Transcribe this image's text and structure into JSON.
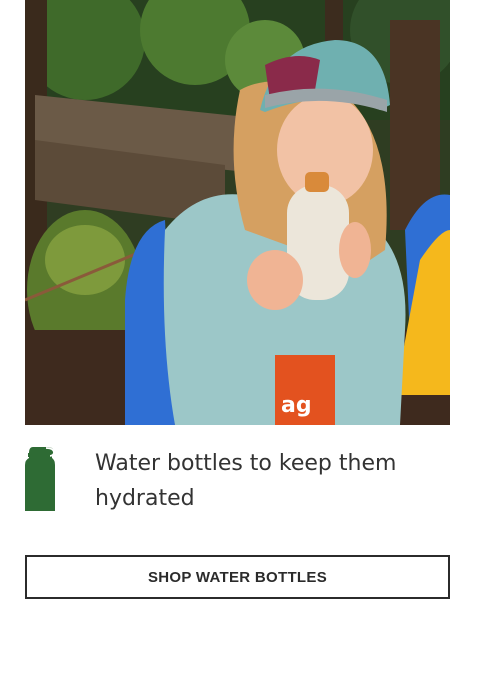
{
  "hero": {
    "image_description_icon": "child-drinking-from-water-bottle-photo",
    "shirt_text": "ag"
  },
  "feature": {
    "icon": "water-bottle-icon",
    "icon_color": "#2e6b34",
    "text": "Water bottles to keep them hydrated"
  },
  "cta": {
    "label": "SHOP WATER BOTTLES"
  }
}
